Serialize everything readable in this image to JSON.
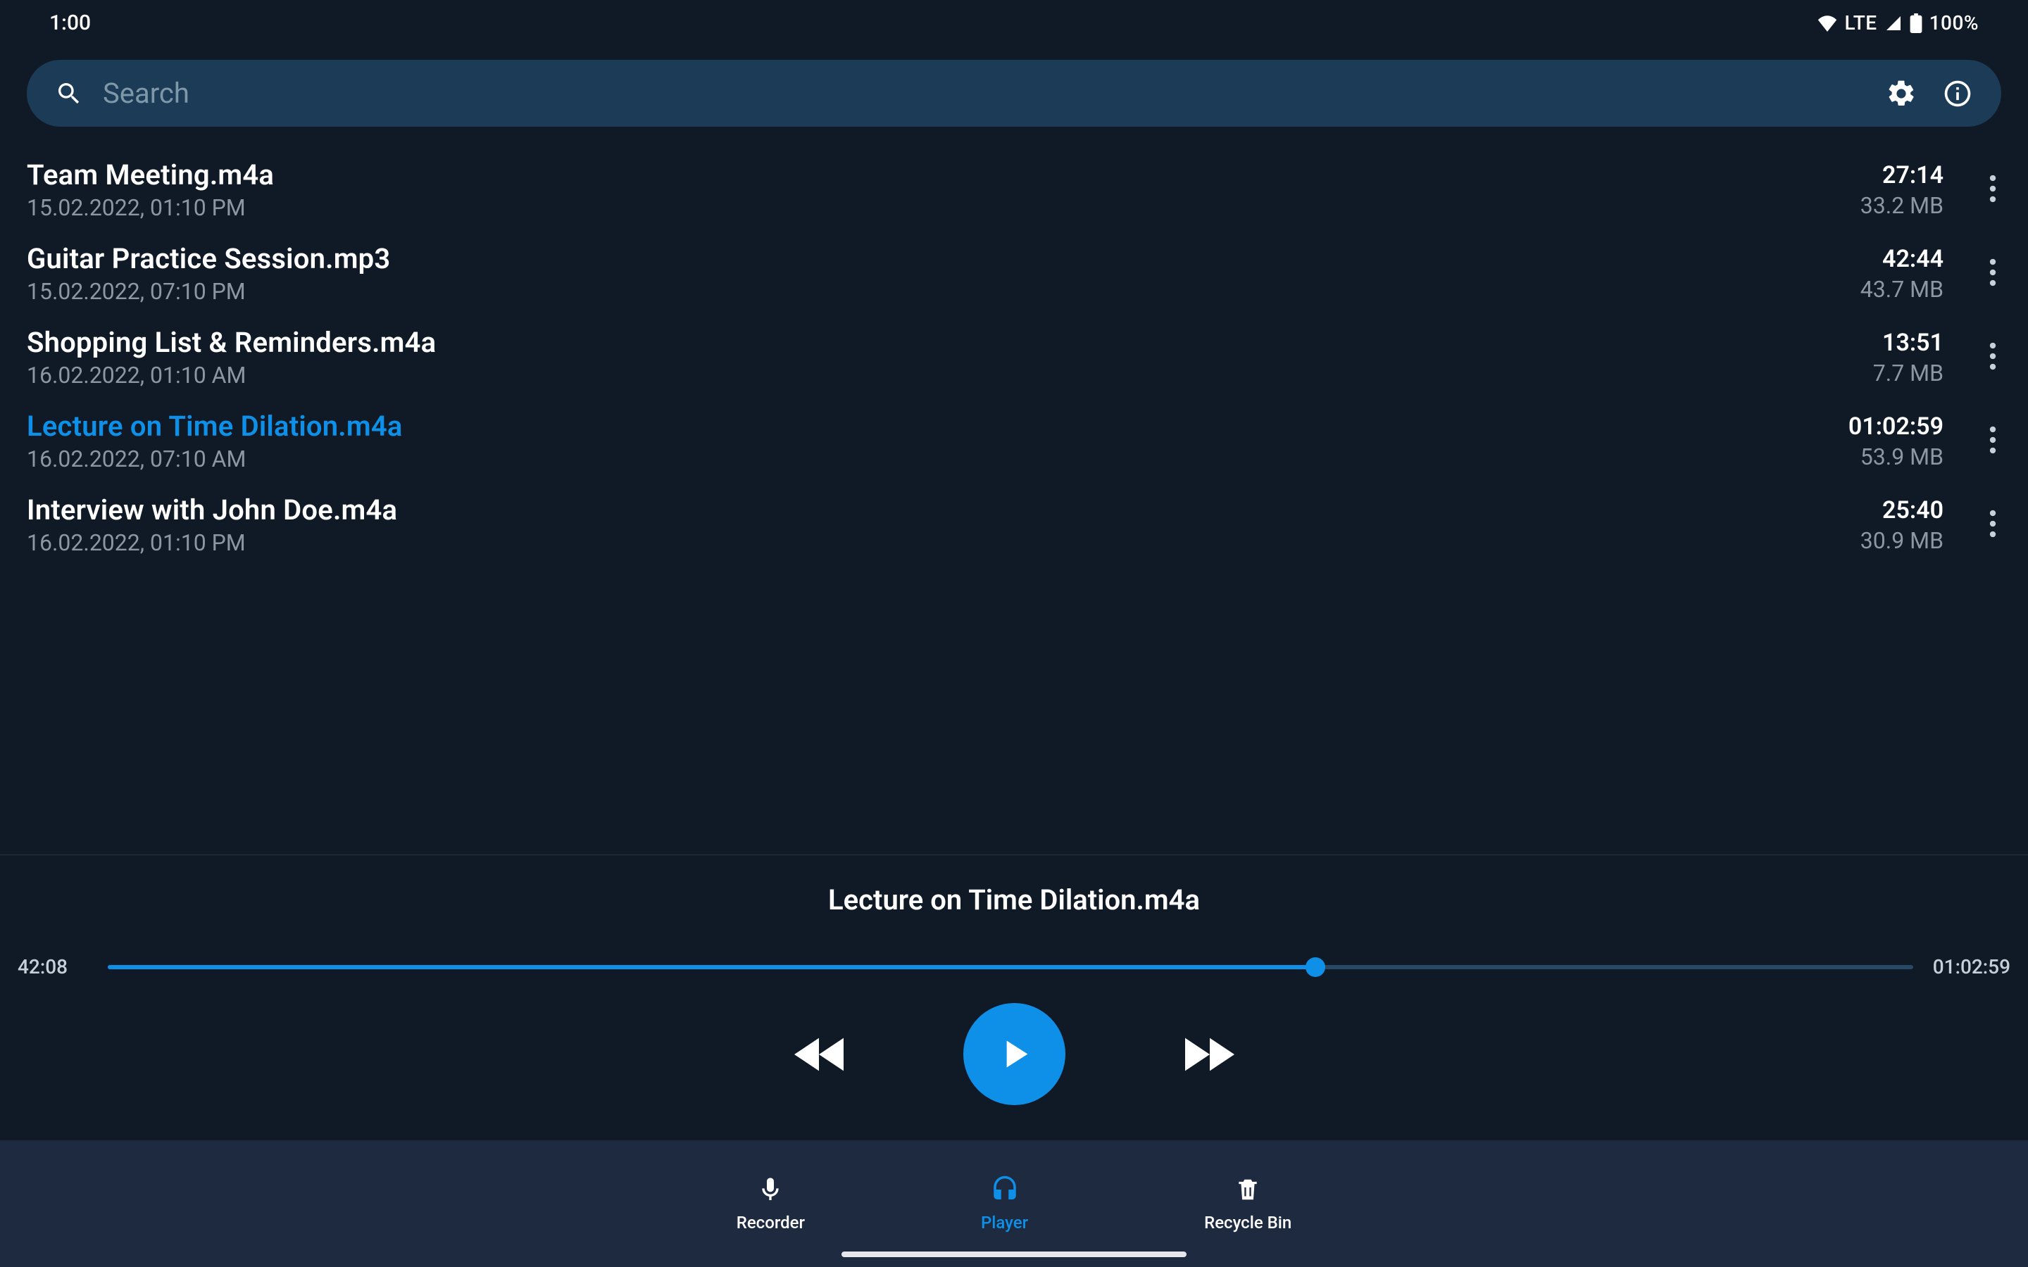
{
  "status": {
    "time": "1:00",
    "network": "LTE",
    "battery": "100%"
  },
  "search": {
    "placeholder": "Search"
  },
  "recordings": [
    {
      "title": "Team Meeting.m4a",
      "date": "15.02.2022, 01:10 PM",
      "duration": "27:14",
      "size": "33.2 MB",
      "active": false
    },
    {
      "title": "Guitar Practice Session.mp3",
      "date": "15.02.2022, 07:10 PM",
      "duration": "42:44",
      "size": "43.7 MB",
      "active": false
    },
    {
      "title": "Shopping List & Reminders.m4a",
      "date": "16.02.2022, 01:10 AM",
      "duration": "13:51",
      "size": "7.7 MB",
      "active": false
    },
    {
      "title": "Lecture on Time Dilation.m4a",
      "date": "16.02.2022, 07:10 AM",
      "duration": "01:02:59",
      "size": "53.9 MB",
      "active": true
    },
    {
      "title": "Interview with John Doe.m4a",
      "date": "16.02.2022, 01:10 PM",
      "duration": "25:40",
      "size": "30.9 MB",
      "active": false
    }
  ],
  "player": {
    "title": "Lecture on Time Dilation.m4a",
    "elapsed": "42:08",
    "total": "01:02:59",
    "progress_pct": 66.9
  },
  "nav": {
    "recorder": "Recorder",
    "player": "Player",
    "recycle": "Recycle Bin"
  }
}
